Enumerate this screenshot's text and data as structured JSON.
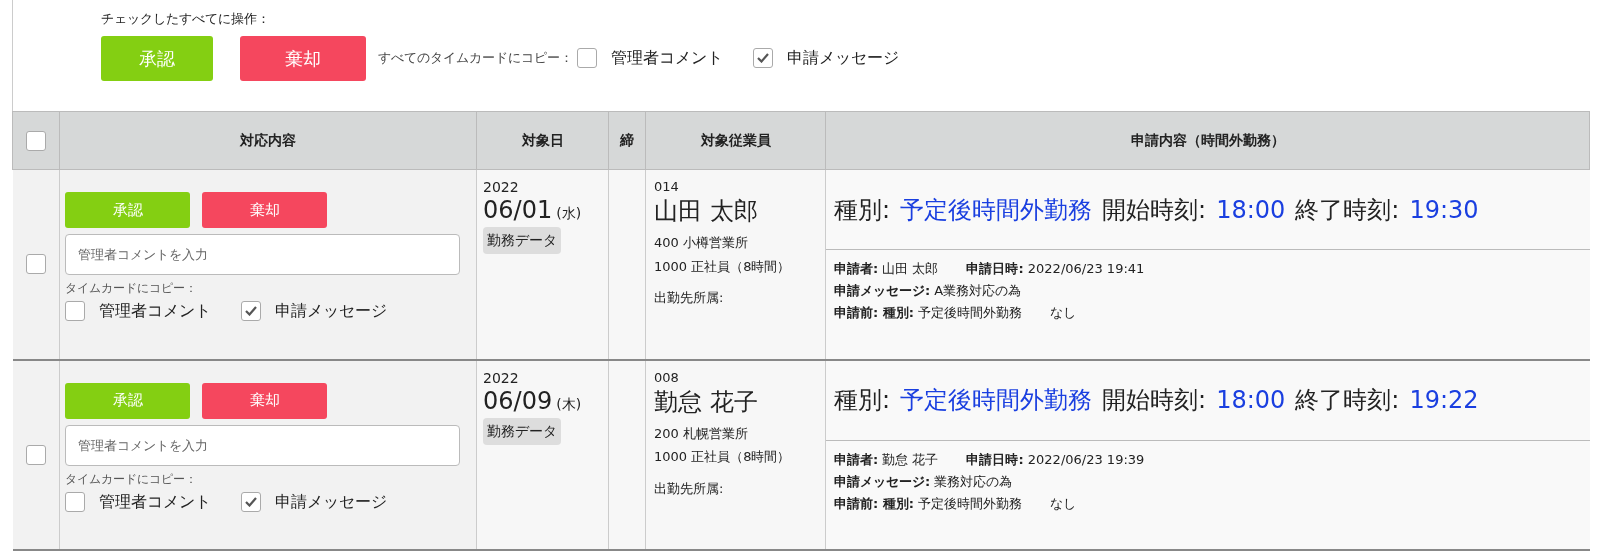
{
  "bulk": {
    "label": "チェックしたすべてに操作：",
    "approve": "承認",
    "reject": "棄却",
    "copy_label": "すべてのタイムカードにコピー：",
    "copy_options": [
      {
        "label": "管理者コメント",
        "checked": false
      },
      {
        "label": "申請メッセージ",
        "checked": true
      }
    ]
  },
  "table": {
    "select_all": {
      "checked": false
    },
    "columns": [
      "対応内容",
      "対象日",
      "締",
      "対象従業員",
      "申請内容（時間外勤務）"
    ],
    "rows": [
      {
        "checked": false,
        "approve": "承認",
        "reject": "棄却",
        "comment_placeholder": "管理者コメントを入力",
        "copy_label": "タイムカードにコピー：",
        "copy_options": [
          {
            "label": "管理者コメント",
            "checked": false
          },
          {
            "label": "申請メッセージ",
            "checked": true
          }
        ],
        "year": "2022",
        "date": "06/01",
        "weekday": "(水)",
        "badge": "勤務データ",
        "emp_code": "014",
        "emp_name": "山田 太郎",
        "dept": "400 小樽営業所",
        "type": "1000 正社員（8時間）",
        "location": "出勤先所属:",
        "headline": [
          {
            "label": "種別:",
            "value": "予定後時間外勤務"
          },
          {
            "label": "開始時刻:",
            "value": "18:00"
          },
          {
            "label": "終了時刻:",
            "value": "19:30"
          }
        ],
        "details": [
          [
            "**申請者:** 山田 太郎",
            "**申請日時:** 2022/06/23 19:41"
          ],
          [
            "**申請メッセージ:** A業務対応の為"
          ],
          [
            "**申請前: 種別:** 予定後時間外勤務",
            "なし"
          ]
        ]
      },
      {
        "checked": false,
        "approve": "承認",
        "reject": "棄却",
        "comment_placeholder": "管理者コメントを入力",
        "copy_label": "タイムカードにコピー：",
        "copy_options": [
          {
            "label": "管理者コメント",
            "checked": false
          },
          {
            "label": "申請メッセージ",
            "checked": true
          }
        ],
        "year": "2022",
        "date": "06/09",
        "weekday": "(木)",
        "badge": "勤務データ",
        "emp_code": "008",
        "emp_name": "勤怠 花子",
        "dept": "200 札幌営業所",
        "type": "1000 正社員（8時間）",
        "location": "出勤先所属:",
        "headline": [
          {
            "label": "種別:",
            "value": "予定後時間外勤務"
          },
          {
            "label": "開始時刻:",
            "value": "18:00"
          },
          {
            "label": "終了時刻:",
            "value": "19:22"
          }
        ],
        "details": [
          [
            "**申請者:** 勤怠 花子",
            "**申請日時:** 2022/06/23 19:39"
          ],
          [
            "**申請メッセージ:** 業務対応の為"
          ],
          [
            "**申請前: 種別:** 予定後時間外勤務",
            "なし"
          ]
        ]
      }
    ]
  }
}
